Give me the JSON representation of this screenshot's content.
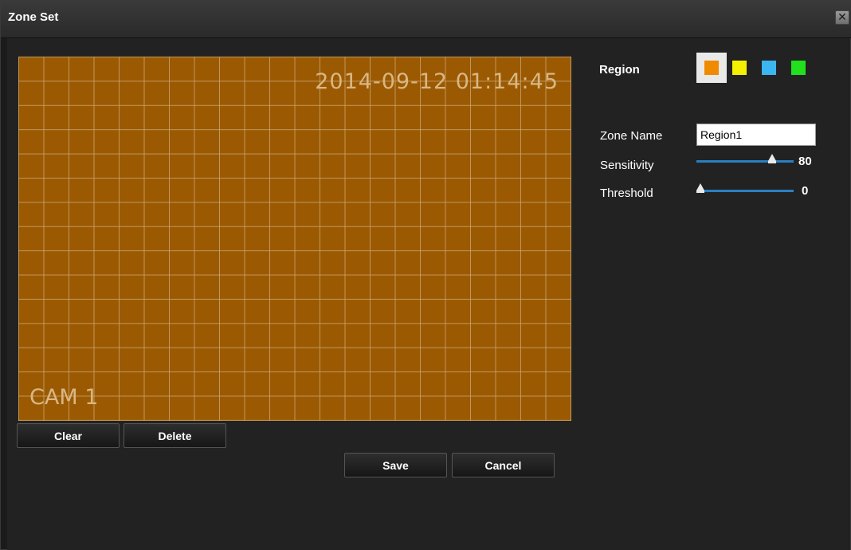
{
  "window": {
    "title": "Zone Set",
    "close_glyph": "✕"
  },
  "video": {
    "timestamp": "2014-09-12 01:14:45",
    "camera_label": "CAM 1"
  },
  "video_buttons": {
    "clear": "Clear",
    "delete": "Delete"
  },
  "footer_buttons": {
    "save": "Save",
    "cancel": "Cancel"
  },
  "region": {
    "label": "Region",
    "colors": [
      "#f08a00",
      "#f5f000",
      "#3bb6f0",
      "#22e01e"
    ],
    "selected_index": 0
  },
  "zone": {
    "name_label": "Zone Name",
    "name_value": "Region1"
  },
  "sensitivity": {
    "label": "Sensitivity",
    "value": "80",
    "fraction": 0.8
  },
  "threshold": {
    "label": "Threshold",
    "value": "0",
    "fraction": 0.0
  },
  "colors": {
    "grid_fill": "#9b5a02",
    "slider_accent": "#2b7fc0"
  },
  "icons": {
    "close": "close-icon",
    "slider_thumb": "slider-thumb-icon"
  }
}
